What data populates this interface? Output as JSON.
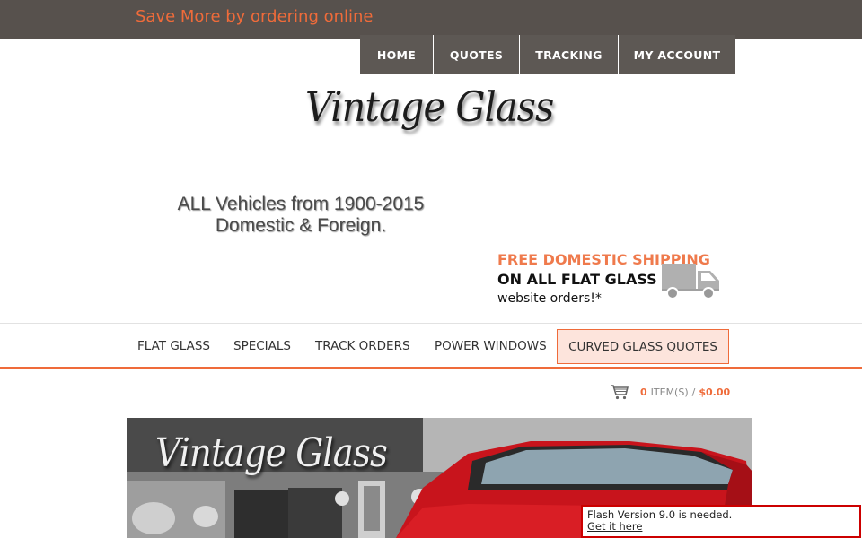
{
  "topbar": {
    "promo": "Save More by ordering online"
  },
  "topnav": {
    "items": [
      "HOME",
      "QUOTES",
      "TRACKING",
      "MY ACCOUNT"
    ]
  },
  "logo": {
    "text": "Vintage Glass"
  },
  "vehicles": {
    "line1": "ALL Vehicles from 1900-2015",
    "line2": "Domestic & Foreign."
  },
  "shipping": {
    "line1": "FREE DOMESTIC SHIPPING",
    "line2": "ON ALL FLAT GLASS",
    "line3": "website orders!*"
  },
  "mainnav": {
    "items": [
      "FLAT GLASS",
      "SPECIALS",
      "TRACK ORDERS",
      "POWER WINDOWS"
    ],
    "quote_button": "CURVED GLASS QUOTES"
  },
  "cart": {
    "count": "0",
    "label": "ITEM(S)",
    "separator": "/",
    "total": "$0.00"
  },
  "banner": {
    "title": "Vintage Glass"
  },
  "flash_notice": {
    "message": "Flash Version 9.0 is needed.",
    "link": "Get it here"
  },
  "colors": {
    "accent": "#ef6b3a",
    "topbar": "#57514d",
    "nav": "#5d5854",
    "car_red": "#c8141c"
  }
}
